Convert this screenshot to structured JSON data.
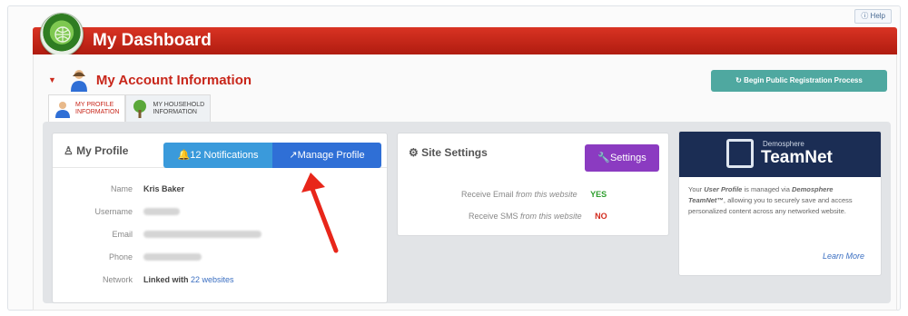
{
  "header": {
    "help_label": "Help",
    "title": "My Dashboard"
  },
  "account": {
    "title": "My Account Information",
    "register_button": "Begin Public Registration Process"
  },
  "tabs": [
    {
      "line1": "MY PROFILE",
      "line2": "INFORMATION",
      "active": true
    },
    {
      "line1": "MY HOUSEHOLD",
      "line2": "INFORMATION",
      "active": false
    }
  ],
  "profile": {
    "title": "My Profile",
    "notifications_label": "12 Notifications",
    "manage_label": "Manage Profile",
    "rows": [
      {
        "label": "Name",
        "value": "Kris Baker"
      },
      {
        "label": "Username",
        "value": ""
      },
      {
        "label": "Email",
        "value": ""
      },
      {
        "label": "Phone",
        "value": ""
      },
      {
        "label": "Network",
        "value_prefix": "Linked with",
        "value_link": "22 websites"
      }
    ]
  },
  "site_settings": {
    "title": "Site Settings",
    "button": "Settings",
    "rows": [
      {
        "label": "Receive Email",
        "suffix": "from this website",
        "value": "YES",
        "color": "#2e9e2e"
      },
      {
        "label": "Receive SMS",
        "suffix": "from this website",
        "value": "NO",
        "color": "#d22b1e"
      }
    ]
  },
  "teamnet": {
    "small": "Demosphere",
    "big": "TeamNet",
    "body_1": "Your",
    "body_em1": "User Profile",
    "body_2": "is managed via",
    "body_em2": "Demosphere TeamNet™",
    "body_3": ", allowing you to securely save and access personalized content across any networked website.",
    "link": "Learn More"
  },
  "colors": {
    "brand_red": "#c8261a",
    "notif_blue": "#3a9adb",
    "manage_blue": "#2f6fd6",
    "settings_purple": "#8b3bc1",
    "teal": "#4fa8a0",
    "teamnet_navy": "#1b2d54"
  }
}
